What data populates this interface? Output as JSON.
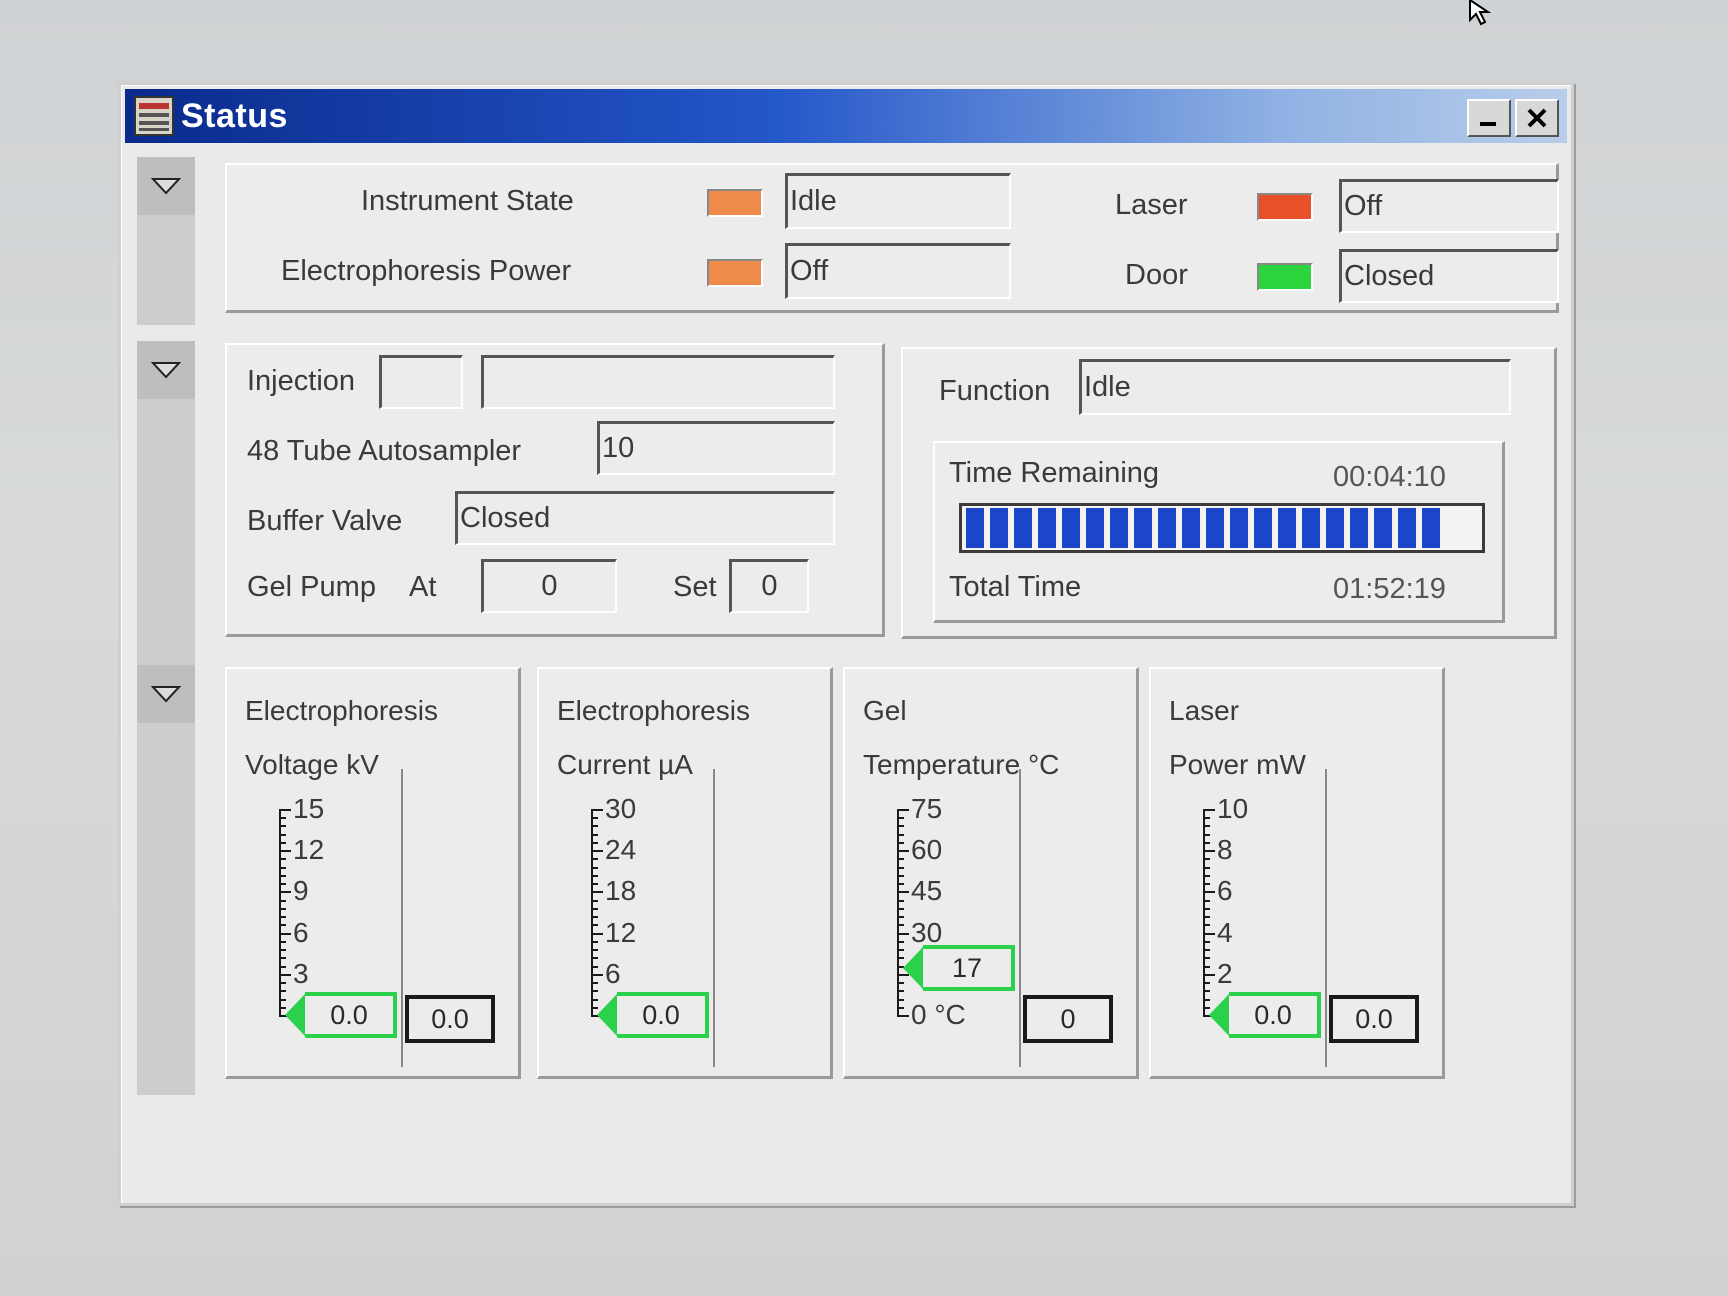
{
  "window": {
    "title": "Status",
    "icon": "app-icon",
    "buttons": [
      "minimize-icon",
      "close-icon"
    ]
  },
  "instrument": {
    "state_label": "Instrument State",
    "state_value": "Idle",
    "state_color": "#ee8a4a",
    "ep_power_label": "Electrophoresis Power",
    "ep_power_value": "Off",
    "ep_power_color": "#ee8a4a",
    "laser_label": "Laser",
    "laser_value": "Off",
    "laser_color": "#e8502a",
    "door_label": "Door",
    "door_value": "Closed",
    "door_color": "#2ed43e"
  },
  "run": {
    "injection_label": "Injection",
    "injection_value1": "",
    "injection_value2": "",
    "autosampler_label": "48 Tube Autosampler",
    "autosampler_value": "10",
    "buffer_label": "Buffer Valve",
    "buffer_value": "Closed",
    "gelpump_label": "Gel Pump",
    "at_label": "At",
    "at_value": "0",
    "set_label": "Set",
    "set_value": "0"
  },
  "function": {
    "label": "Function",
    "value": "Idle",
    "time_remaining_label": "Time Remaining",
    "time_remaining": "00:04:10",
    "total_time_label": "Total Time",
    "total_time": "01:52:19",
    "progress_fraction": 0.96,
    "progress_color": "#1b46c9"
  },
  "gauges": [
    {
      "title1": "Electrophoresis",
      "title2": "Voltage  kV",
      "ticks": [
        "15",
        "12",
        "9",
        "6",
        "3"
      ],
      "max": 15,
      "value": "0.0",
      "value_num": 0,
      "set": "0.0",
      "has_set": true,
      "unit": ""
    },
    {
      "title1": "Electrophoresis",
      "title2": "Current  µA",
      "ticks": [
        "30",
        "24",
        "18",
        "12",
        "6"
      ],
      "max": 30,
      "value": "0.0",
      "value_num": 0,
      "set": "",
      "has_set": false,
      "unit": ""
    },
    {
      "title1": "Gel",
      "title2": "Temperature °C",
      "ticks": [
        "75",
        "60",
        "45",
        "30"
      ],
      "bottom_tick": "0",
      "max": 75,
      "value": "17",
      "value_num": 17,
      "set": "0",
      "has_set": true,
      "unit": "°C"
    },
    {
      "title1": "Laser",
      "title2": "Power  mW",
      "ticks": [
        "10",
        "8",
        "6",
        "4",
        "2"
      ],
      "max": 10,
      "value": "0.0",
      "value_num": 0,
      "set": "0.0",
      "has_set": true,
      "unit": ""
    }
  ],
  "colors": {
    "needle": "#2bd14a",
    "title_bar": "#1b3fa8"
  }
}
